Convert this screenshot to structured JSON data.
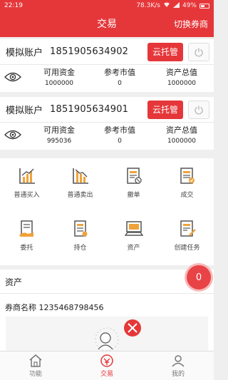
{
  "status_bar": {
    "time": "22:19",
    "speed": "78.3K/s",
    "battery": "49%"
  },
  "header": {
    "title": "交易",
    "switch_label": "切换券商"
  },
  "accounts": [
    {
      "name": "模拟账户",
      "number": "1851905634902",
      "cloud_label": "云托管",
      "stats": [
        {
          "label": "可用资金",
          "value": "1000000"
        },
        {
          "label": "参考市值",
          "value": "0"
        },
        {
          "label": "资产总值",
          "value": "1000000"
        }
      ]
    },
    {
      "name": "模拟账户",
      "number": "1851905634901",
      "cloud_label": "云托管",
      "stats": [
        {
          "label": "可用资金",
          "value": "995036"
        },
        {
          "label": "参考市值",
          "value": "0"
        },
        {
          "label": "资产总值",
          "value": "1000000"
        }
      ]
    }
  ],
  "functions": [
    {
      "label": "普通买入",
      "icon": "buy-chart-icon"
    },
    {
      "label": "普通卖出",
      "icon": "sell-chart-icon"
    },
    {
      "label": "撤单",
      "icon": "cancel-order-icon"
    },
    {
      "label": "成交",
      "icon": "deal-icon"
    },
    {
      "label": "委托",
      "icon": "entrust-icon"
    },
    {
      "label": "持仓",
      "icon": "position-icon"
    },
    {
      "label": "资产",
      "icon": "asset-icon"
    },
    {
      "label": "创建任务",
      "icon": "create-task-icon"
    }
  ],
  "assets": {
    "title": "资产",
    "broker": "券商名称 1235468798456",
    "badge": "0"
  },
  "tabbar": [
    {
      "label": "功能",
      "icon": "home-icon",
      "active": false
    },
    {
      "label": "交易",
      "icon": "trade-icon",
      "active": true
    },
    {
      "label": "我的",
      "icon": "user-icon",
      "active": false
    }
  ],
  "colors": {
    "accent": "#e5373a",
    "icon_orange": "#f0a23a",
    "background": "#efefef"
  }
}
